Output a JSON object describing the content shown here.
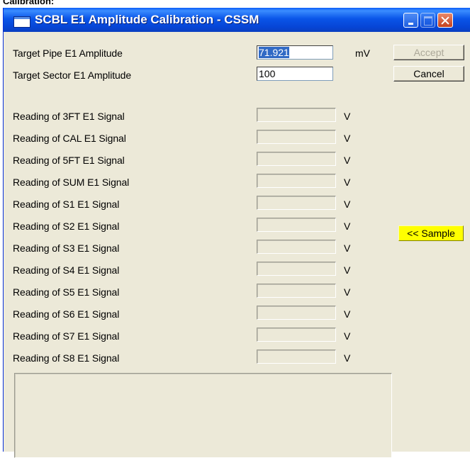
{
  "background_caption": "Calibration:",
  "window": {
    "title": "SCBL E1 Amplitude Calibration - CSSM"
  },
  "fields": {
    "target_pipe": {
      "label": "Target Pipe E1 Amplitude",
      "value": "71.921",
      "unit": "mV"
    },
    "target_sector": {
      "label": "Target Sector E1 Amplitude",
      "value": "100"
    }
  },
  "readings": [
    {
      "label": "Reading of 3FT E1 Signal",
      "unit": "V"
    },
    {
      "label": "Reading of CAL E1 Signal",
      "unit": "V"
    },
    {
      "label": "Reading of 5FT E1 Signal",
      "unit": "V"
    },
    {
      "label": "Reading of SUM E1 Signal",
      "unit": "V"
    },
    {
      "label": "Reading of S1 E1 Signal",
      "unit": "V"
    },
    {
      "label": "Reading of S2 E1 Signal",
      "unit": "V"
    },
    {
      "label": "Reading of S3 E1 Signal",
      "unit": "V"
    },
    {
      "label": "Reading of S4 E1 Signal",
      "unit": "V"
    },
    {
      "label": "Reading of S5 E1 Signal",
      "unit": "V"
    },
    {
      "label": "Reading of S6 E1 Signal",
      "unit": "V"
    },
    {
      "label": "Reading of S7 E1 Signal",
      "unit": "V"
    },
    {
      "label": "Reading of S8 E1 Signal",
      "unit": "V"
    }
  ],
  "buttons": {
    "accept": "Accept",
    "cancel": "Cancel",
    "sample": "<< Sample"
  },
  "colors": {
    "titlebar": "#0a55e8",
    "window_bg": "#ece9d8",
    "sample_button": "#ffff00",
    "selection": "#316ac5"
  }
}
